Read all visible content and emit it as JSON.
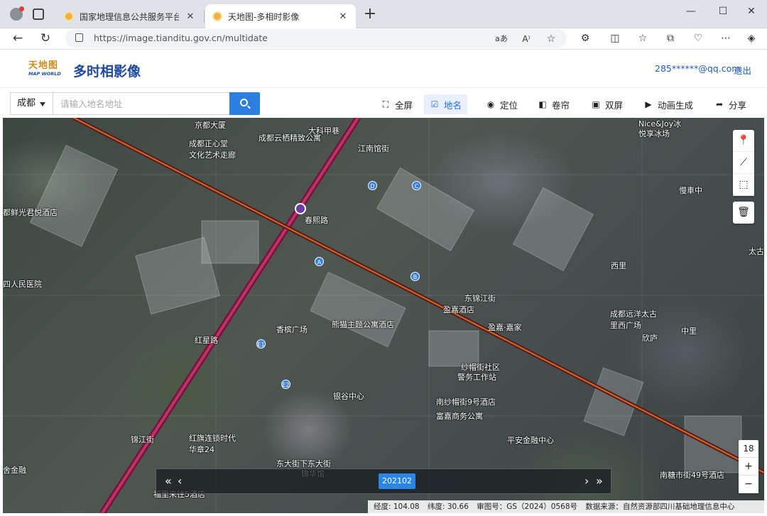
{
  "browser": {
    "tabs": [
      {
        "title": "国家地理信息公共服务平台 天地图",
        "active": false
      },
      {
        "title": "天地图-多相时影像",
        "active": true
      }
    ],
    "new_tab": "+",
    "url_host": "https://image.tianditu.gov.cn",
    "url_path": "/multidate",
    "window_controls": {
      "minimize": "—",
      "maximize": "☐",
      "close": "✕"
    },
    "read_aloud": "aあ",
    "aa": "A⁾"
  },
  "site": {
    "logo_cn": "天地图",
    "logo_en": "MAP WORLD",
    "title": "多时相影像",
    "user": "285******@qq.com",
    "logout": "退出"
  },
  "toolbar": {
    "city": "成都",
    "search_placeholder": "请输入地名地址",
    "buttons": [
      {
        "label": "全屏",
        "icon": "fullscreen-icon",
        "glyph": "⛶",
        "active": false
      },
      {
        "label": "地名",
        "icon": "checkbox-icon",
        "glyph": "☑",
        "active": true
      },
      {
        "label": "定位",
        "icon": "locate-icon",
        "glyph": "◉",
        "active": false
      },
      {
        "label": "卷帘",
        "icon": "swipe-icon",
        "glyph": "◧",
        "active": false
      },
      {
        "label": "双屏",
        "icon": "dual-screen-icon",
        "glyph": "▣",
        "active": false
      },
      {
        "label": "动画生成",
        "icon": "animation-icon",
        "glyph": "▶",
        "active": false
      },
      {
        "label": "分享",
        "icon": "share-icon",
        "glyph": "➦",
        "active": false
      }
    ]
  },
  "map": {
    "labels": [
      {
        "text": "京都大厦"
      },
      {
        "text": "成都正心堂"
      },
      {
        "text": "文化艺术走廊"
      },
      {
        "text": "成都云栖精致公寓"
      },
      {
        "text": "大科甲巷"
      },
      {
        "text": "江南馆街"
      },
      {
        "text": "都鲜光君悦酒店"
      },
      {
        "text": "春熙路"
      },
      {
        "text": "四人民医院"
      },
      {
        "text": "东锦江街"
      },
      {
        "text": "盈嘉酒店"
      },
      {
        "text": "香槟广场"
      },
      {
        "text": "熊猫主题公寓酒店"
      },
      {
        "text": "盈嘉·嘉家"
      },
      {
        "text": "纱帽街社区"
      },
      {
        "text": "警务工作站"
      },
      {
        "text": "银谷中心"
      },
      {
        "text": "南纱帽街9号酒店"
      },
      {
        "text": "富嘉商务公寓"
      },
      {
        "text": "红旗连锁时代"
      },
      {
        "text": "华章24"
      },
      {
        "text": "平安金融中心"
      },
      {
        "text": "东大街下东大街"
      },
      {
        "text": "锦华馆"
      },
      {
        "text": "福里来往5酒店"
      },
      {
        "text": "Nice&Joy冰"
      },
      {
        "text": "悦享冰场"
      },
      {
        "text": "慢車中"
      },
      {
        "text": "中里"
      },
      {
        "text": "西里"
      },
      {
        "text": "成都远洋太古"
      },
      {
        "text": "里西广场"
      },
      {
        "text": "欣庐"
      },
      {
        "text": "南糖市街49号酒店"
      },
      {
        "text": "红星路"
      },
      {
        "text": "锦江街"
      },
      {
        "text": "太古"
      },
      {
        "text": "舍金融"
      }
    ],
    "poi_markers": [
      "A",
      "B",
      "C",
      "D",
      "E1",
      "E2"
    ],
    "right_tools": [
      {
        "name": "marker-icon",
        "glyph": "📍"
      },
      {
        "name": "measure-line-icon",
        "glyph": "⟋"
      },
      {
        "name": "measure-area-icon",
        "glyph": "⬚"
      }
    ],
    "trash_glyph": "🗑",
    "zoom": {
      "level": "18",
      "in": "+",
      "out": "−"
    },
    "timeline": {
      "date": "202102",
      "prev_all": "«",
      "prev": "‹",
      "next": "›",
      "next_all": "»"
    },
    "status": {
      "lon": "经度: 104.08",
      "lat": "纬度: 30.66",
      "review": "审图号：GS（2024）0568号",
      "source": "数据来源：自然资源部四川基础地理信息中心"
    }
  }
}
